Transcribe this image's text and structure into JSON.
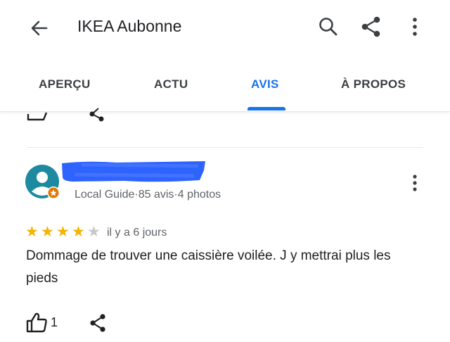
{
  "header": {
    "title": "IKEA Aubonne",
    "icons": [
      "back-arrow-icon",
      "search-icon",
      "share-icon",
      "more-vert-icon"
    ]
  },
  "tabs": [
    {
      "label": "APERÇU",
      "active": false
    },
    {
      "label": "ACTU",
      "active": false
    },
    {
      "label": "AVIS",
      "active": true
    },
    {
      "label": "À PROPOS",
      "active": false
    }
  ],
  "review": {
    "author_meta": "Local Guide·85 avis·4 photos",
    "rating": 4,
    "max_rating": 5,
    "date": "il y a 6 jours",
    "text": "Dommage de trouver une caissière voilée.  J y mettrai plus les pieds",
    "likes": "1",
    "author_name_redacted": true
  },
  "colors": {
    "accent": "#1a73e8",
    "star": "#f4b400",
    "redaction": "#2f63ff",
    "avatar_bg": "#1e8aa0",
    "guide_badge": "#e37400"
  }
}
